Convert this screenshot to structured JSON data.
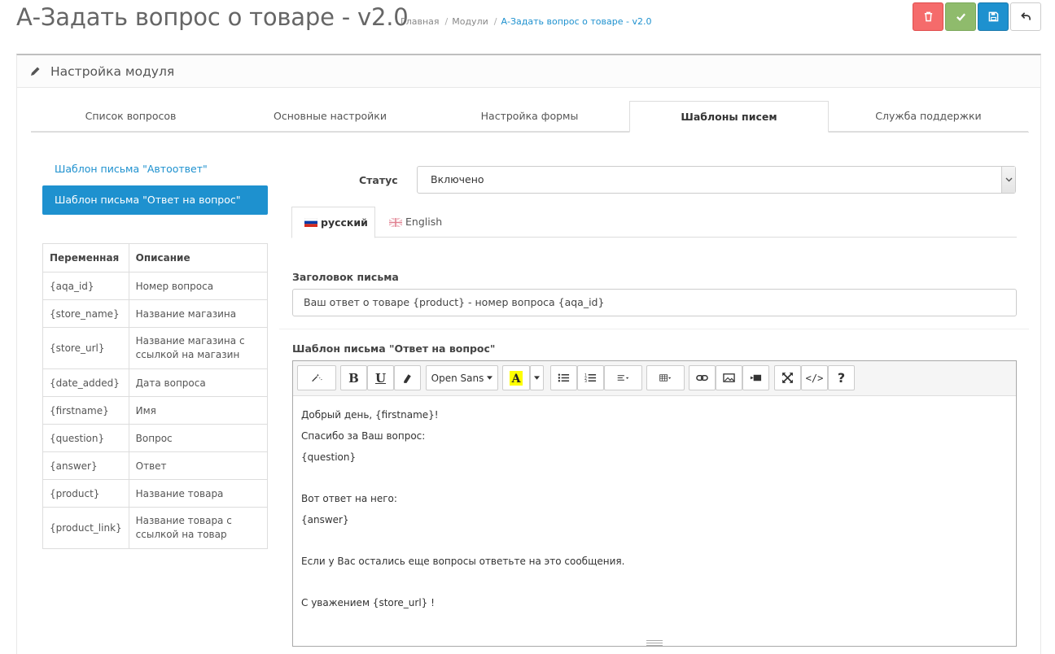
{
  "header": {
    "title": "А-Задать вопрос о товаре - v2.0",
    "breadcrumb": [
      "Главная",
      "Модули",
      "А-Задать вопрос о товаре - v2.0"
    ],
    "separator": "/"
  },
  "panel": {
    "title": "Настройка модуля"
  },
  "tabs": [
    {
      "label": "Список вопросов"
    },
    {
      "label": "Основные настройки"
    },
    {
      "label": "Настройка формы"
    },
    {
      "label": "Шаблоны писем",
      "active": true
    },
    {
      "label": "Служба поддержки"
    }
  ],
  "templates": {
    "link": "Шаблон письма \"Автоответ\"",
    "active": "Шаблон письма \"Ответ на вопрос\""
  },
  "vars_table": {
    "headers": [
      "Переменная",
      "Описание"
    ],
    "rows": [
      [
        "{aqa_id}",
        "Номер вопроса"
      ],
      [
        "{store_name}",
        "Название магазина"
      ],
      [
        "{store_url}",
        "Название магазина с ссылкой на магазин"
      ],
      [
        "{date_added}",
        "Дата вопроса"
      ],
      [
        "{firstname}",
        "Имя"
      ],
      [
        "{question}",
        "Вопрос"
      ],
      [
        "{answer}",
        "Ответ"
      ],
      [
        "{product}",
        "Название товара"
      ],
      [
        "{product_link}",
        "Название товара с ссылкой на товар"
      ]
    ]
  },
  "form": {
    "status_label": "Статус",
    "status_value": "Включено",
    "languages": [
      "русский",
      "English"
    ],
    "subject_label": "Заголовок письма",
    "subject_value": "Ваш ответ о товаре {product} - номер вопроса {aqa_id}",
    "template_label": "Шаблон письма \"Ответ на вопрос\""
  },
  "editor": {
    "font": "Open Sans",
    "help": "?",
    "code": "</>",
    "lines": [
      "Добрый день, {firstname}!",
      "Спасибо за Ваш вопрос:",
      "{question}",
      "",
      "Вот ответ на него:",
      "{answer}",
      "",
      "Если у Вас остались еще вопросы ответьте на это сообщения.",
      "",
      "С уважением {store_url} !"
    ]
  },
  "colors": {
    "accent": "#1e91cf",
    "danger": "#f56b6b",
    "success": "#8fbb6c"
  }
}
